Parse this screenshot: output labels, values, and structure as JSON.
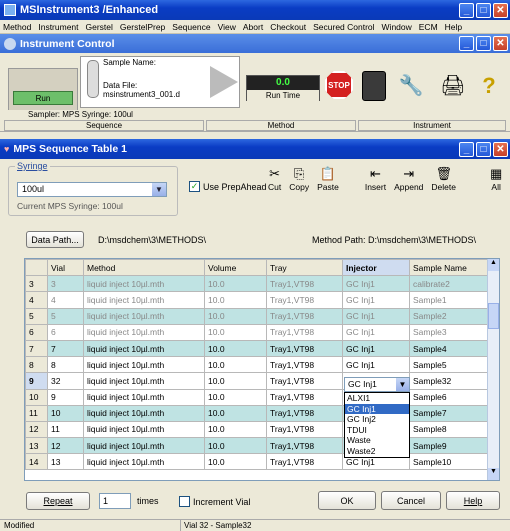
{
  "app": {
    "title": "MSInstrument3 /Enhanced"
  },
  "menu": [
    "Method",
    "Instrument",
    "Gerstel",
    "GerstelPrep",
    "Sequence",
    "View",
    "Abort",
    "Checkout",
    "Secured Control",
    "Window",
    "ECM",
    "Help"
  ],
  "instrument": {
    "title": "Instrument Control",
    "run_label": "Run",
    "sample_name_label": "Sample Name:",
    "data_file_label": "Data File:",
    "data_file_value": "msinstrument3_001.d",
    "run_time_value": "0.0",
    "run_time_label": "Run Time",
    "stop_label": "STOP",
    "sampler_status": "Sampler: MPS   Syringe: 100ul",
    "sections": [
      "Sequence",
      "Method",
      "Instrument"
    ]
  },
  "seq": {
    "title": "MPS Sequence Table 1",
    "syringe_group": "Syringe",
    "syringe_value": "100ul",
    "current_syringe": "Current MPS Syringe: 100ul",
    "prepahead": "Use PrepAhead",
    "tools": [
      {
        "icon": "scissors-icon",
        "glyph": "✂",
        "label": "Cut"
      },
      {
        "icon": "copy-icon",
        "glyph": "⎘",
        "label": "Copy"
      },
      {
        "icon": "paste-icon",
        "glyph": "📋",
        "label": "Paste"
      },
      {
        "icon": "insert-icon",
        "glyph": "⇤",
        "label": "Insert"
      },
      {
        "icon": "append-icon",
        "glyph": "⇥",
        "label": "Append"
      },
      {
        "icon": "delete-icon",
        "glyph": "🗑",
        "label": "Delete"
      },
      {
        "icon": "all-icon",
        "glyph": "▦",
        "label": "All"
      }
    ],
    "data_path_btn": "Data Path...",
    "data_path": "D:\\msdchem\\3\\METHODS\\",
    "method_path": "Method Path:  D:\\msdchem\\3\\METHODS\\",
    "columns": [
      "",
      "Vial",
      "Method",
      "Volume",
      "Tray",
      "Injector",
      "Sample Name"
    ],
    "rows": [
      [
        "3",
        "3",
        "liquid inject 10µl.mth",
        "10.0",
        "Tray1,VT98",
        "GC Inj1",
        "calibrate2"
      ],
      [
        "4",
        "4",
        "liquid inject 10µl.mth",
        "10.0",
        "Tray1,VT98",
        "GC Inj1",
        "Sample1"
      ],
      [
        "5",
        "5",
        "liquid inject 10µl.mth",
        "10.0",
        "Tray1,VT98",
        "GC Inj1",
        "Sample2"
      ],
      [
        "6",
        "6",
        "liquid inject 10µl.mth",
        "10.0",
        "Tray1,VT98",
        "GC Inj1",
        "Sample3"
      ],
      [
        "7",
        "7",
        "liquid inject 10µl.mth",
        "10.0",
        "Tray1,VT98",
        "GC Inj1",
        "Sample4"
      ],
      [
        "8",
        "8",
        "liquid inject 10µl.mth",
        "10.0",
        "Tray1,VT98",
        "GC Inj1",
        "Sample5"
      ],
      [
        "9",
        "32",
        "liquid inject 10µl.mth",
        "10.0",
        "Tray1,VT98",
        "GC Inj1",
        "Sample32"
      ],
      [
        "10",
        "9",
        "liquid inject 10µl.mth",
        "10.0",
        "Tray1,VT98",
        "GC Inj1",
        "Sample6"
      ],
      [
        "11",
        "10",
        "liquid inject 10µl.mth",
        "10.0",
        "Tray1,VT98",
        "GC Inj1",
        "Sample7"
      ],
      [
        "12",
        "11",
        "liquid inject 10µl.mth",
        "10.0",
        "Tray1,VT98",
        "GC Inj1",
        "Sample8"
      ],
      [
        "13",
        "12",
        "liquid inject 10µl.mth",
        "10.0",
        "Tray1,VT98",
        "GC Inj1",
        "Sample9"
      ],
      [
        "14",
        "13",
        "liquid inject 10µl.mth",
        "10.0",
        "Tray1,VT98",
        "GC Inj1",
        "Sample10"
      ]
    ],
    "dropdown": [
      "ALXI1",
      "GC Inj1",
      "GC Inj2",
      "TDUI",
      "Waste",
      "Waste2"
    ],
    "dropdown_selected": "GC Inj1",
    "repeat_btn": "Repeat",
    "repeat_value": "1",
    "times": "times",
    "increment": "Increment Vial",
    "ok": "OK",
    "cancel": "Cancel",
    "help": "Help"
  },
  "status": {
    "left": "Modified",
    "center": "Vial 32 - Sample32"
  }
}
